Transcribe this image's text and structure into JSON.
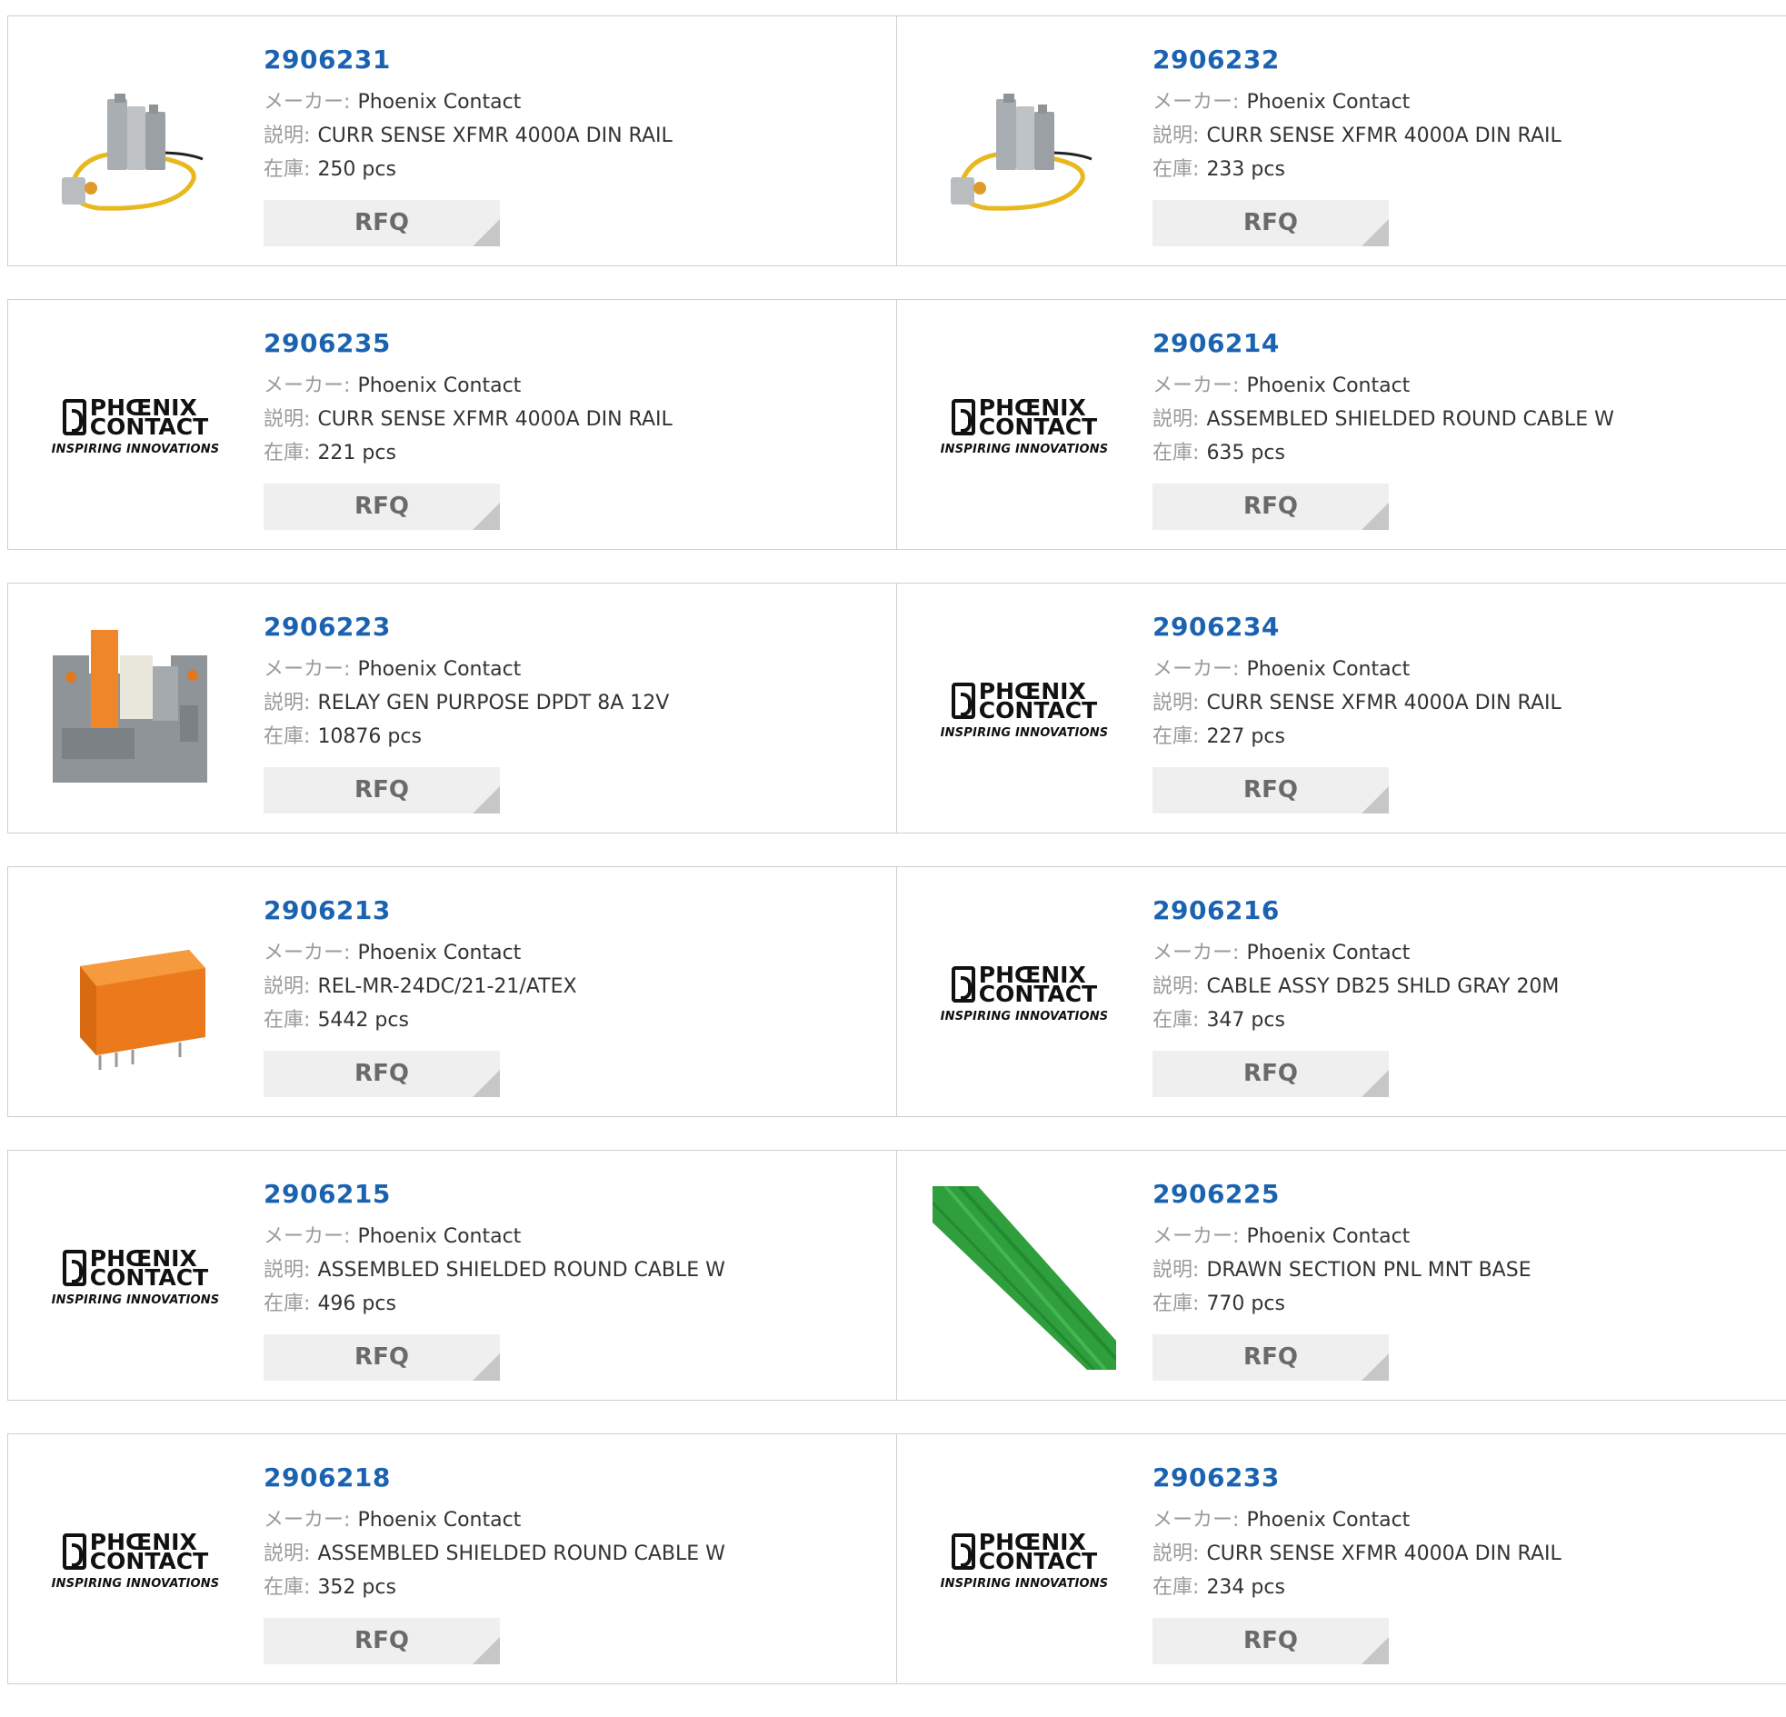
{
  "labels": {
    "manufacturer": "メーカー",
    "description": "説明",
    "stock": "在庫",
    "separator": ":",
    "rfq": "RFQ"
  },
  "logo": {
    "line1": "PHŒNIX",
    "line2": "CONTACT",
    "tagline": "INSPIRING INNOVATIONS"
  },
  "products": [
    {
      "part": "2906231",
      "manufacturer": "Phoenix Contact",
      "description": "CURR SENSE XFMR 4000A DIN RAIL",
      "stock": "250 pcs",
      "image": "current-sensor-photo"
    },
    {
      "part": "2906232",
      "manufacturer": "Phoenix Contact",
      "description": "CURR SENSE XFMR 4000A DIN RAIL",
      "stock": "233 pcs",
      "image": "current-sensor-photo"
    },
    {
      "part": "2906235",
      "manufacturer": "Phoenix Contact",
      "description": "CURR SENSE XFMR 4000A DIN RAIL",
      "stock": "221 pcs",
      "image": "phoenix-contact-logo"
    },
    {
      "part": "2906214",
      "manufacturer": "Phoenix Contact",
      "description": "ASSEMBLED SHIELDED ROUND CABLE W",
      "stock": "635 pcs",
      "image": "phoenix-contact-logo"
    },
    {
      "part": "2906223",
      "manufacturer": "Phoenix Contact",
      "description": "RELAY GEN PURPOSE DPDT 8A 12V",
      "stock": "10876 pcs",
      "image": "relay-module-photo"
    },
    {
      "part": "2906234",
      "manufacturer": "Phoenix Contact",
      "description": "CURR SENSE XFMR 4000A DIN RAIL",
      "stock": "227 pcs",
      "image": "phoenix-contact-logo"
    },
    {
      "part": "2906213",
      "manufacturer": "Phoenix Contact",
      "description": "REL-MR-24DC/21-21/ATEX",
      "stock": "5442 pcs",
      "image": "orange-relay-photo"
    },
    {
      "part": "2906216",
      "manufacturer": "Phoenix Contact",
      "description": "CABLE ASSY DB25 SHLD GRAY 20M",
      "stock": "347 pcs",
      "image": "phoenix-contact-logo"
    },
    {
      "part": "2906215",
      "manufacturer": "Phoenix Contact",
      "description": "ASSEMBLED SHIELDED ROUND CABLE W",
      "stock": "496 pcs",
      "image": "phoenix-contact-logo"
    },
    {
      "part": "2906225",
      "manufacturer": "Phoenix Contact",
      "description": "DRAWN SECTION PNL MNT BASE",
      "stock": "770 pcs",
      "image": "green-profile-photo"
    },
    {
      "part": "2906218",
      "manufacturer": "Phoenix Contact",
      "description": "ASSEMBLED SHIELDED ROUND CABLE W",
      "stock": "352 pcs",
      "image": "phoenix-contact-logo"
    },
    {
      "part": "2906233",
      "manufacturer": "Phoenix Contact",
      "description": "CURR SENSE XFMR 4000A DIN RAIL",
      "stock": "234 pcs",
      "image": "phoenix-contact-logo"
    }
  ],
  "colors": {
    "link": "#1b63b0",
    "label": "#9a9a9a",
    "value": "#333333",
    "button_bg": "#efefef",
    "button_text": "#6a6a6a",
    "border": "#cfcfcf"
  }
}
